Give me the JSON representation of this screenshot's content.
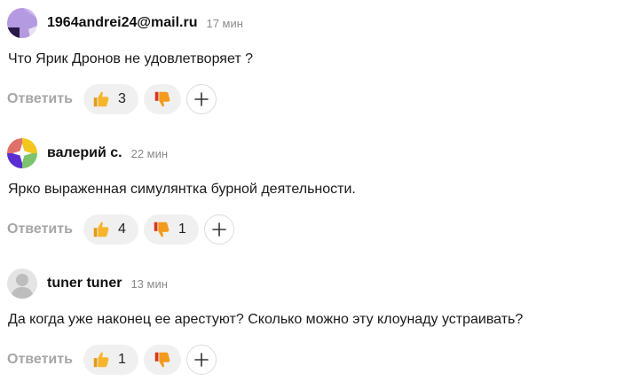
{
  "comments": [
    {
      "author": "1964andrei24@mail.ru",
      "time": "17 мин",
      "text": "Что Ярик Дронов не удовлетворяет ?",
      "reply_label": "Ответить",
      "likes": "3",
      "dislikes": ""
    },
    {
      "author": "валерий с.",
      "time": "22 мин",
      "text": "Ярко выраженная симулянтка бурной деятельности.",
      "reply_label": "Ответить",
      "likes": "4",
      "dislikes": "1"
    },
    {
      "author": "tuner tuner",
      "time": "13 мин",
      "text": "Да когда уже наконец ее арестуют? Сколько можно эту клоунаду устраивать?",
      "reply_label": "Ответить",
      "likes": "1",
      "dislikes": ""
    }
  ],
  "colors": {
    "like": "#f7b52c",
    "dislike": "#f29a1c",
    "reply": "#a6a6a6",
    "pill_bg": "#f0f0f0"
  }
}
